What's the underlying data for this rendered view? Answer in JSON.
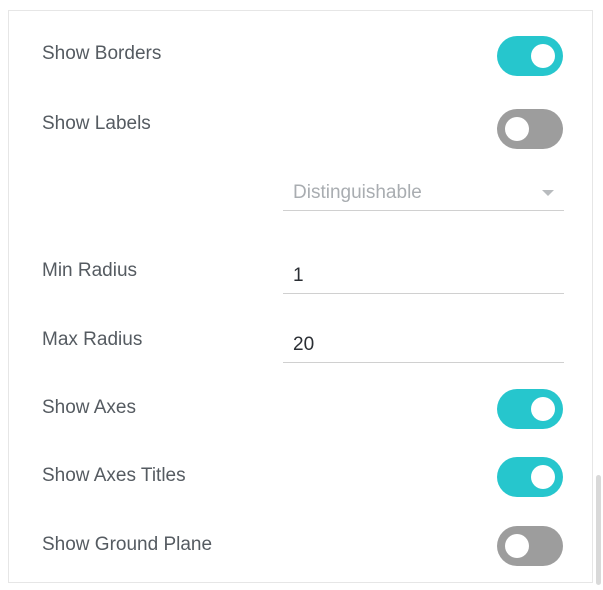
{
  "settings": {
    "show_borders": {
      "label": "Show Borders",
      "on": true
    },
    "show_labels": {
      "label": "Show Labels",
      "on": false
    },
    "label_mode": {
      "value": "Distinguishable"
    },
    "min_radius": {
      "label": "Min Radius",
      "value": "1"
    },
    "max_radius": {
      "label": "Max Radius",
      "value": "20"
    },
    "show_axes": {
      "label": "Show Axes",
      "on": true
    },
    "show_axes_titles": {
      "label": "Show Axes Titles",
      "on": true
    },
    "show_ground_plane": {
      "label": "Show Ground Plane",
      "on": false
    }
  },
  "colors": {
    "toggle_on": "#26c6cd",
    "toggle_off": "#9d9d9d"
  },
  "icons": {
    "dropdown": "chevron-down-icon"
  }
}
